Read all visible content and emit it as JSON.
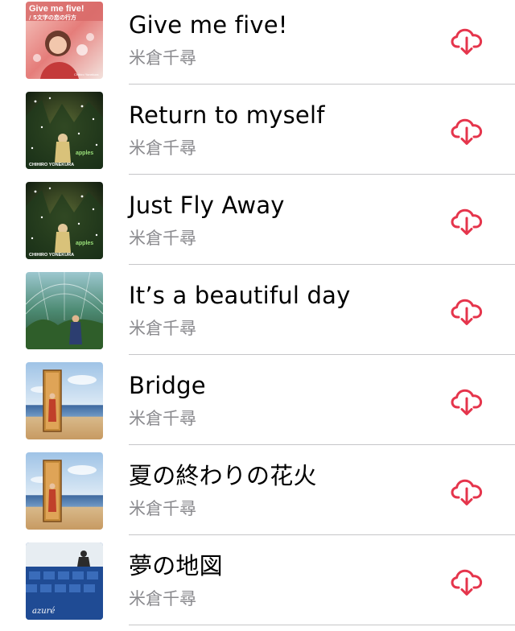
{
  "colors": {
    "accent": "#e5354c",
    "title": "#000000",
    "subtitle": "#8a8a8e",
    "separator": "#c6c6c8"
  },
  "songs": [
    {
      "title": "Give me five!",
      "artist": "米倉千尋",
      "cover": {
        "style": "give-me-five",
        "heading": "Give me five!",
        "subheading": "/ 5文字の恋の行方",
        "footer": "Chihiro Yonekura"
      },
      "action_icon": "cloud-download-icon"
    },
    {
      "title": "Return to myself",
      "artist": "米倉千尋",
      "cover": {
        "style": "forest",
        "brand": "apples",
        "footer": "CHIHIRO YONEKURA"
      },
      "action_icon": "cloud-download-icon"
    },
    {
      "title": "Just Fly Away",
      "artist": "米倉千尋",
      "cover": {
        "style": "forest",
        "brand": "apples",
        "footer": "CHIHIRO YONEKURA"
      },
      "action_icon": "cloud-download-icon"
    },
    {
      "title": "It’s a beautiful day",
      "artist": "米倉千尋",
      "cover": {
        "style": "greenhouse"
      },
      "action_icon": "cloud-download-icon"
    },
    {
      "title": "Bridge",
      "artist": "米倉千尋",
      "cover": {
        "style": "beach"
      },
      "action_icon": "cloud-download-icon"
    },
    {
      "title": "夏の終わりの花火",
      "artist": "米倉千尋",
      "cover": {
        "style": "beach"
      },
      "action_icon": "cloud-download-icon"
    },
    {
      "title": "夢の地図",
      "artist": "米倉千尋",
      "cover": {
        "style": "azure",
        "brand": "azuré"
      },
      "action_icon": "cloud-download-icon"
    }
  ]
}
